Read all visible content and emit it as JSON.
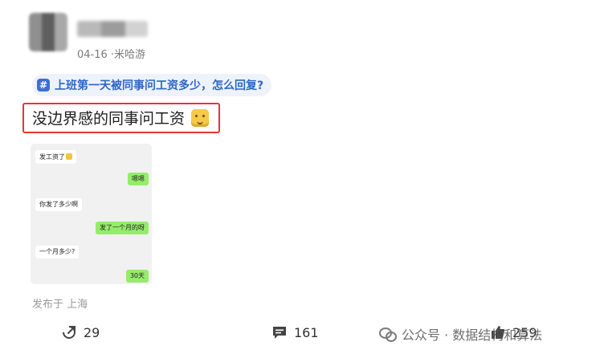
{
  "post": {
    "date": "04-16",
    "source": "·米哈游",
    "topic": "上班第一天被同事问工资多少，怎么回复?",
    "content": "没边界感的同事问工资",
    "location": "发布于 上海"
  },
  "chat_image": {
    "messages": [
      {
        "side": "left",
        "text": "发工资了"
      },
      {
        "side": "right",
        "text": "嗯嗯"
      },
      {
        "side": "left",
        "text": "你发了多少啊"
      },
      {
        "side": "right",
        "text": "发了一个月的呀"
      },
      {
        "side": "left",
        "text": "一个月多少?"
      },
      {
        "side": "right",
        "text": "30天"
      }
    ]
  },
  "actions": {
    "share_count": "29",
    "comment_count": "161",
    "like_count": "259"
  },
  "watermark": "公众号 · 数据结构和算法",
  "colors": {
    "topic_blue": "#2f66c8",
    "highlight_red": "#e63535",
    "chat_green": "#95ec69"
  }
}
